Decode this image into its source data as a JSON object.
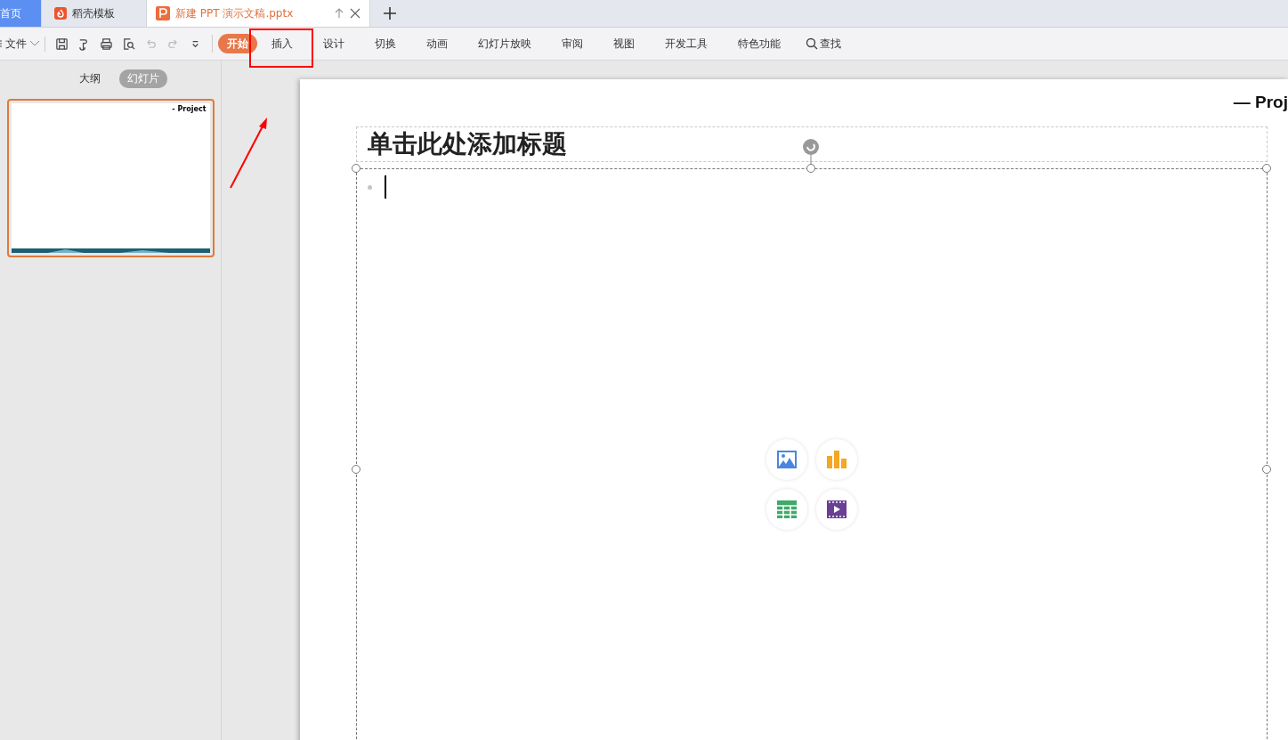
{
  "tabs": [
    {
      "label": "首页",
      "kind": "home",
      "selected": false
    },
    {
      "label": "稻壳模板",
      "kind": "docer",
      "selected": false
    },
    {
      "label": "新建 PPT 演示文稿.pptx",
      "kind": "document",
      "selected": true
    }
  ],
  "toolbar": {
    "file_menu": "文件",
    "quick_actions": [
      {
        "kind": "save",
        "disabled": false
      },
      {
        "kind": "painter",
        "disabled": false
      },
      {
        "kind": "print",
        "disabled": false
      },
      {
        "kind": "preview",
        "disabled": false
      },
      {
        "kind": "undo",
        "disabled": true
      },
      {
        "kind": "redo",
        "disabled": true
      },
      {
        "kind": "more",
        "disabled": false
      }
    ],
    "ribbon_tabs": [
      {
        "label": "开始",
        "selected": true
      },
      {
        "label": "插入",
        "selected": false
      },
      {
        "label": "设计",
        "selected": false
      },
      {
        "label": "切换",
        "selected": false
      },
      {
        "label": "动画",
        "selected": false
      },
      {
        "label": "幻灯片放映",
        "selected": false
      },
      {
        "label": "审阅",
        "selected": false
      },
      {
        "label": "视图",
        "selected": false
      },
      {
        "label": "开发工具",
        "selected": false
      },
      {
        "label": "特色功能",
        "selected": false
      }
    ],
    "search": "查找"
  },
  "sidebar": {
    "views": [
      {
        "label": "大纲",
        "selected": false
      },
      {
        "label": "幻灯片",
        "selected": true
      }
    ],
    "thumbnails": [
      {
        "caption": "- Project",
        "selected": true
      }
    ]
  },
  "slide": {
    "corner_text": "— Proj",
    "title_placeholder": "单击此处添加标题",
    "insert_buttons": [
      {
        "kind": "picture"
      },
      {
        "kind": "chart"
      },
      {
        "kind": "table"
      },
      {
        "kind": "video"
      }
    ]
  }
}
